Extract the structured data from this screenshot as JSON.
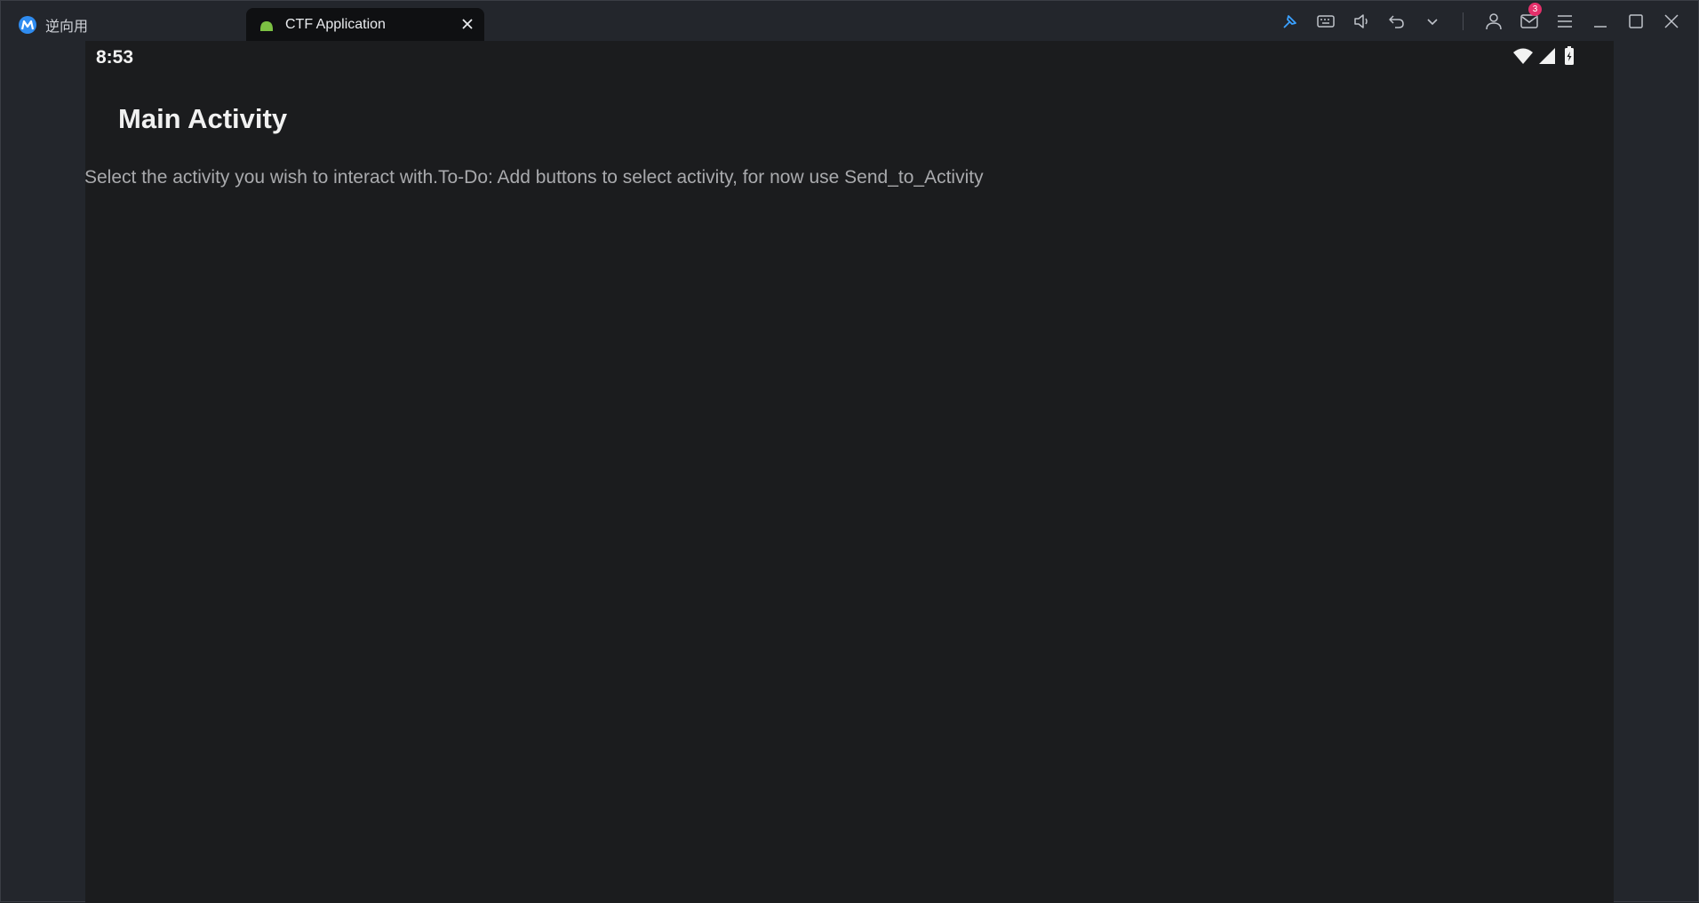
{
  "titlebar": {
    "tabs": [
      {
        "label": "逆向用",
        "active": false,
        "icon": "app-logo-icon"
      },
      {
        "label": "CTF Application",
        "active": true,
        "icon": "android-icon"
      }
    ],
    "toolbar": {
      "icons": [
        "pin-icon",
        "keyboard-icon",
        "volume-icon",
        "undo-icon",
        "chevron-down-icon",
        "user-icon",
        "mail-icon",
        "menu-icon",
        "minimize-icon",
        "maximize-icon",
        "close-icon"
      ],
      "mail_badge": "3"
    }
  },
  "phone": {
    "status": {
      "time": "8:53"
    },
    "appbar": {
      "title": "Main Activity"
    },
    "body": {
      "text": "Select the activity you wish to interact with.To-Do: Add buttons to select activity, for now use Send_to_Activity"
    }
  },
  "colors": {
    "accent": "#2f8cf0",
    "badge": "#e5306b",
    "android": "#7cc143",
    "screen_bg": "#1b1c1e"
  }
}
